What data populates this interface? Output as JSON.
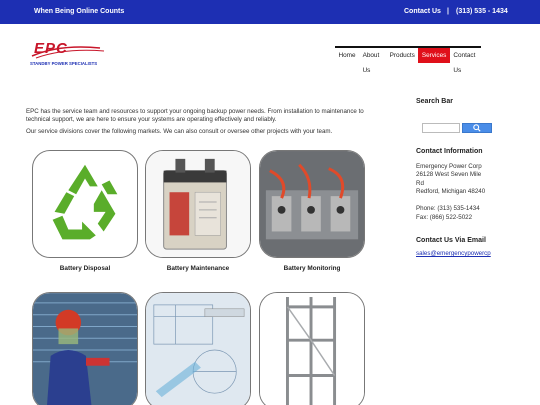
{
  "topbar": {
    "tagline": "When Being Online Counts",
    "contact_label": "Contact Us",
    "separator": "|",
    "phone": "(313) 535 - 1434"
  },
  "logo": {
    "mark": "EPC",
    "subtitle": "STANDBY POWER SPECIALISTS"
  },
  "nav": {
    "items": [
      {
        "label": "Home"
      },
      {
        "label": "About Us"
      },
      {
        "label": "Products"
      },
      {
        "label": "Services",
        "active": true
      },
      {
        "label": "Contact Us"
      }
    ]
  },
  "intro": {
    "p1": "EPC has the service team and resources to support your ongoing backup power needs. From installation to maintenance to technical support, we are here to ensure your systems are operating effectively and reliably.",
    "p2": "Our service divisions cover the following markets. We can also consult or oversee other projects with your team."
  },
  "services": [
    {
      "label": "Battery Disposal",
      "icon": "recycle-icon"
    },
    {
      "label": "Battery Maintenance",
      "icon": "battery-image"
    },
    {
      "label": "Battery Monitoring",
      "icon": "monitoring-image"
    }
  ],
  "sidebar": {
    "search_title": "Search Bar",
    "contact_title": "Contact Information",
    "company": "Emergency Power Corp",
    "address1": "26128 West Seven Mile",
    "address2": "Rd",
    "address3": "Redford, Michigan 48240",
    "phone": "Phone: (313) 535-1434",
    "fax": "Fax: (866) 522-5022",
    "email_title": "Contact Us Via Email",
    "email": "sales@emergencypowercp"
  },
  "colors": {
    "topbar": "#1d2fb3",
    "nav_active": "#e0101a",
    "logo_red": "#c8162a",
    "recycle_green": "#5aad2a"
  }
}
